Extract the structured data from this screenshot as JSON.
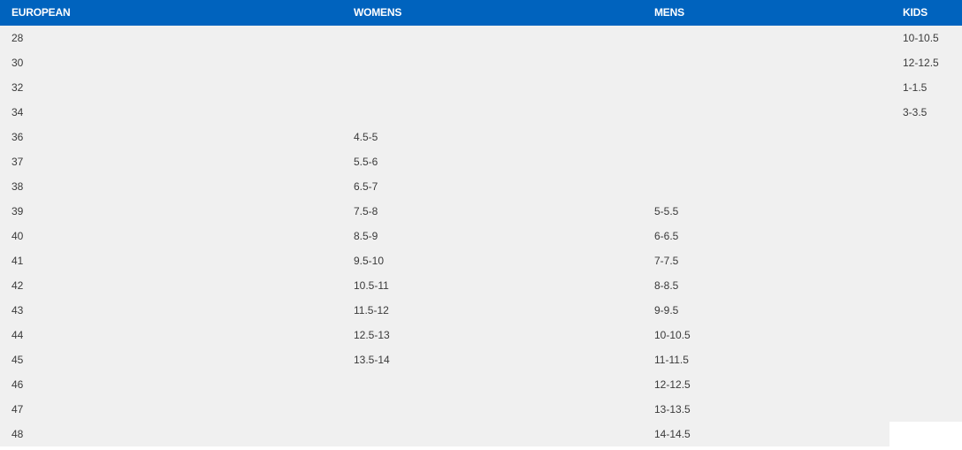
{
  "colors": {
    "header_bg": "#0063be",
    "header_text": "#ffffff",
    "body_bg": "#f0f0f0",
    "cell_text": "#3a3a3a"
  },
  "table": {
    "headers": {
      "european": "EUROPEAN",
      "womens": "WOMENS",
      "mens": "MENS",
      "kids": "KIDS"
    },
    "rows": [
      {
        "european": "28",
        "womens": "",
        "mens": "",
        "kids": "10-10.5"
      },
      {
        "european": "30",
        "womens": "",
        "mens": "",
        "kids": "12-12.5"
      },
      {
        "european": "32",
        "womens": "",
        "mens": "",
        "kids": "1-1.5"
      },
      {
        "european": "34",
        "womens": "",
        "mens": "",
        "kids": "3-3.5"
      },
      {
        "european": "36",
        "womens": "4.5-5",
        "mens": "",
        "kids": ""
      },
      {
        "european": "37",
        "womens": "5.5-6",
        "mens": "",
        "kids": ""
      },
      {
        "european": "38",
        "womens": "6.5-7",
        "mens": "",
        "kids": ""
      },
      {
        "european": "39",
        "womens": "7.5-8",
        "mens": "5-5.5",
        "kids": ""
      },
      {
        "european": "40",
        "womens": "8.5-9",
        "mens": "6-6.5",
        "kids": ""
      },
      {
        "european": "41",
        "womens": "9.5-10",
        "mens": "7-7.5",
        "kids": ""
      },
      {
        "european": "42",
        "womens": "10.5-11",
        "mens": "8-8.5",
        "kids": ""
      },
      {
        "european": "43",
        "womens": "11.5-12",
        "mens": "9-9.5",
        "kids": ""
      },
      {
        "european": "44",
        "womens": "12.5-13",
        "mens": "10-10.5",
        "kids": ""
      },
      {
        "european": "45",
        "womens": "13.5-14",
        "mens": "11-11.5",
        "kids": ""
      },
      {
        "european": "46",
        "womens": "",
        "mens": "12-12.5",
        "kids": ""
      },
      {
        "european": "47",
        "womens": "",
        "mens": "13-13.5",
        "kids": ""
      },
      {
        "european": "48",
        "womens": "",
        "mens": "14-14.5",
        "kids": ""
      }
    ]
  }
}
